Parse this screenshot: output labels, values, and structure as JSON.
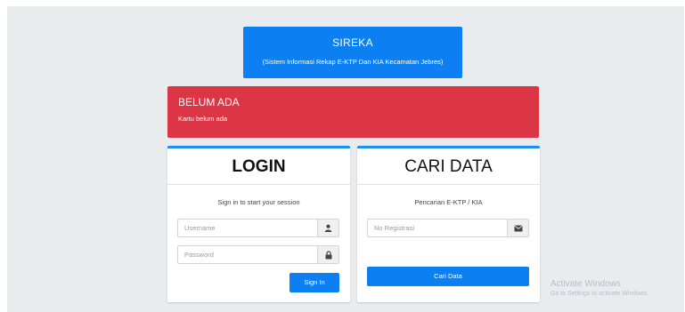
{
  "header": {
    "title": "SIREKA",
    "subtitle": "(Sistem Informasi Rekap E-KTP Dan KIA Kecamatan Jebres)"
  },
  "alert": {
    "heading": "BELUM ADA",
    "message": "Kartu belum ada",
    "color": "#dc3545"
  },
  "login": {
    "title": "LOGIN",
    "subtitle": "Sign in to start your session",
    "username_placeholder": "Username",
    "username_value": "",
    "username_icon": "user-icon",
    "password_placeholder": "Password",
    "password_value": "",
    "password_icon": "lock-icon",
    "button_label": "Sign In"
  },
  "search": {
    "title": "CARI DATA",
    "subtitle": "Pencarian E-KTP / KIA",
    "registration_placeholder": "No Registrasi",
    "registration_value": "",
    "registration_icon": "envelope-icon",
    "button_label": "Cari Data"
  },
  "watermark": {
    "line1": "Activate Windows",
    "line2": "Go to Settings to activate Windows."
  },
  "colors": {
    "primary": "#0c7ff2",
    "danger": "#dc3545",
    "background": "#e9ecef"
  }
}
